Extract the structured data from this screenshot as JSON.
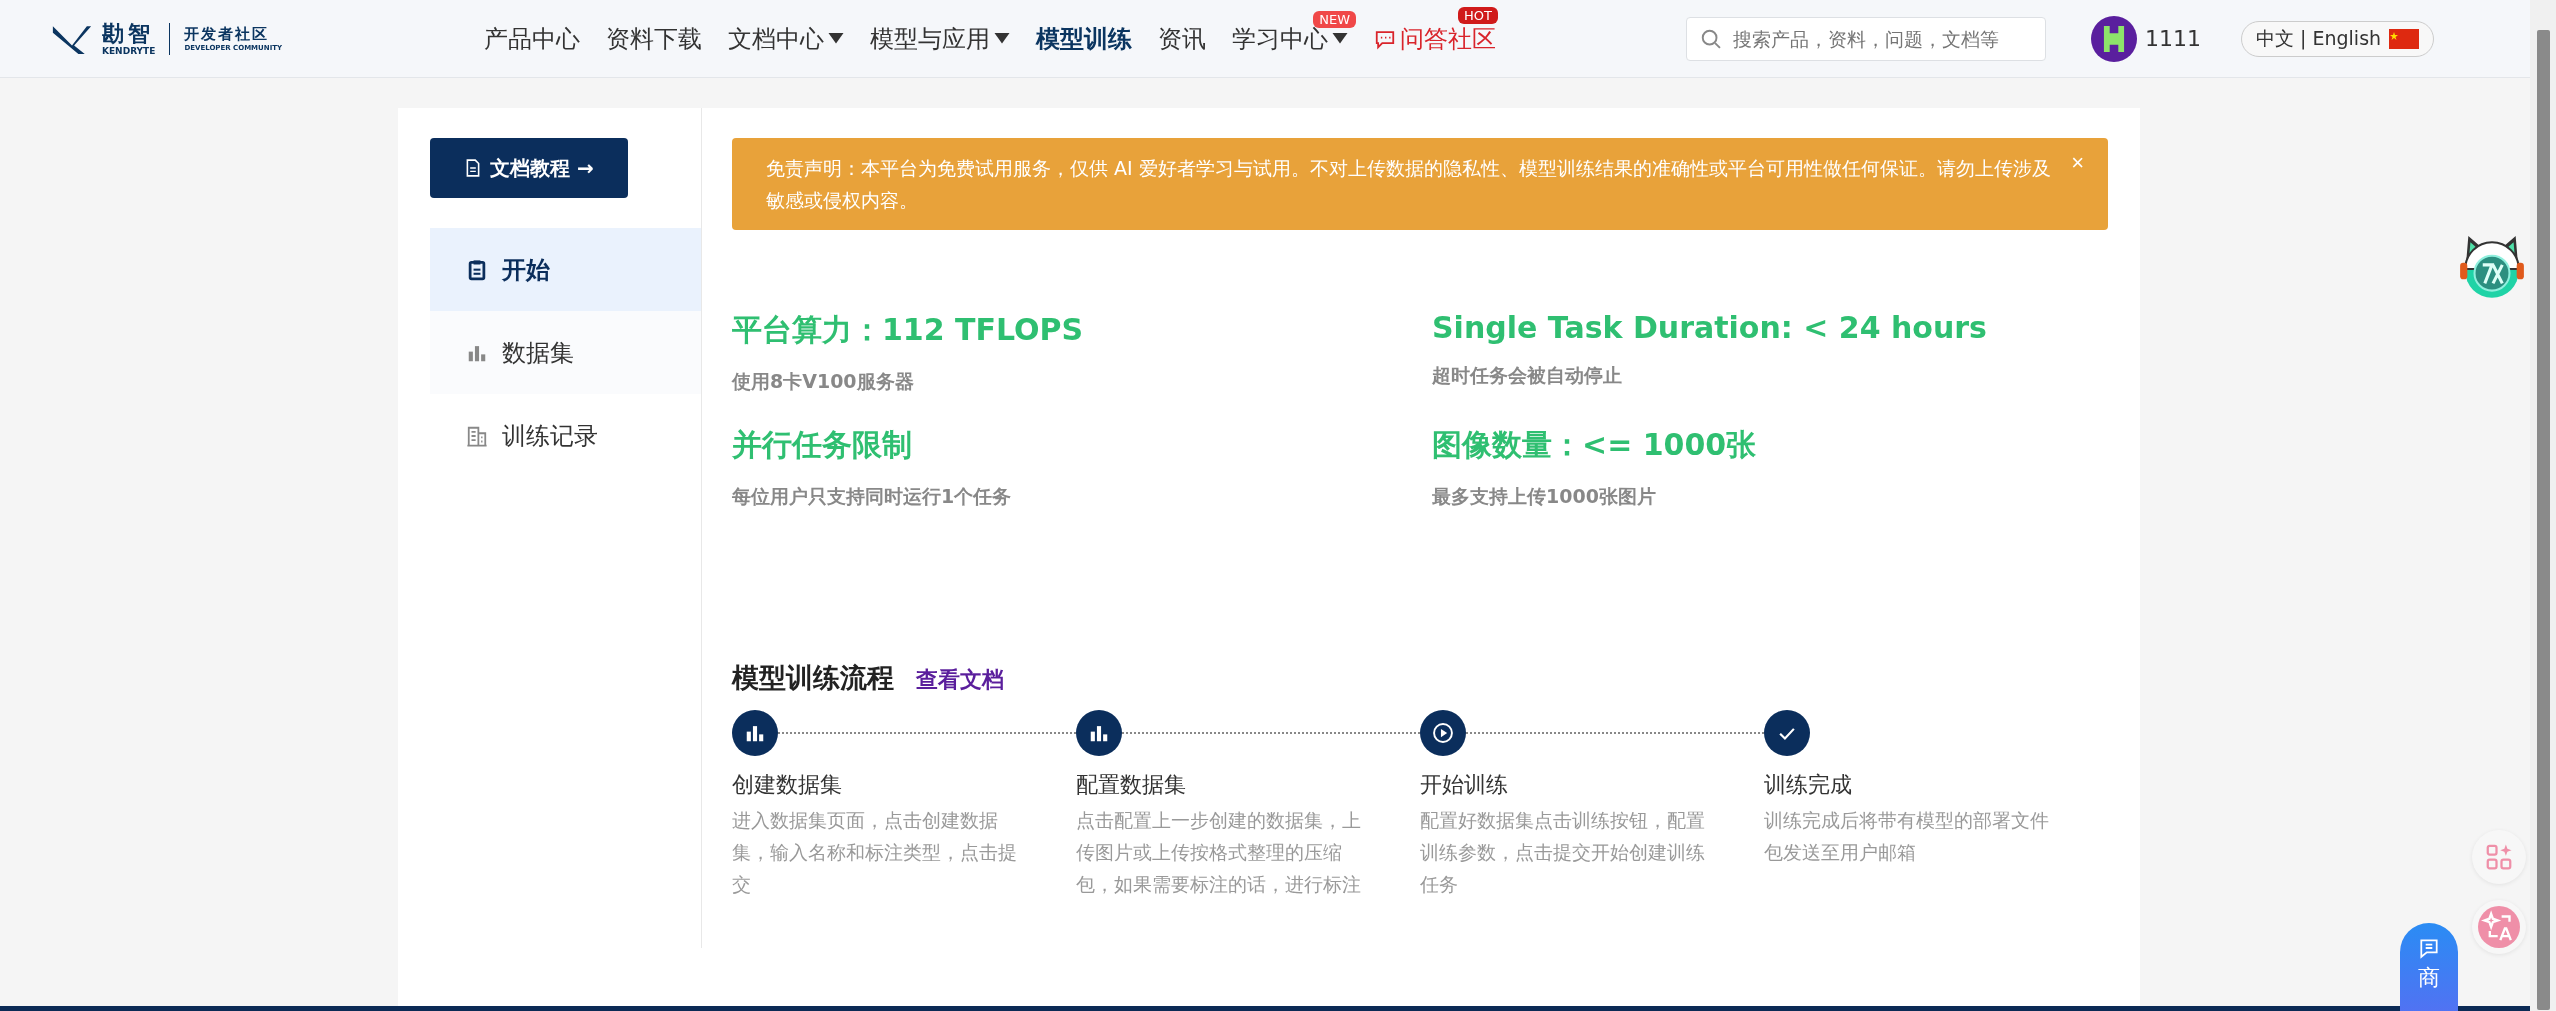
{
  "header": {
    "logo": {
      "mark": "勘智",
      "sub": "KENDRYTE",
      "community": "开发者社区",
      "community_sub": "DEVELOPER COMMUNITY"
    },
    "nav": [
      {
        "label": "产品中心",
        "dropdown": false,
        "selected": false
      },
      {
        "label": "资料下载",
        "dropdown": false,
        "selected": false
      },
      {
        "label": "文档中心",
        "dropdown": true,
        "selected": false
      },
      {
        "label": "模型与应用",
        "dropdown": true,
        "selected": false
      },
      {
        "label": "模型训练",
        "dropdown": false,
        "selected": true
      },
      {
        "label": "资讯",
        "dropdown": false,
        "selected": false
      },
      {
        "label": "学习中心",
        "dropdown": true,
        "selected": false,
        "badge": "NEW"
      },
      {
        "label": "问答社区",
        "dropdown": false,
        "selected": false,
        "badge": "HOT",
        "kind": "community"
      }
    ],
    "search": {
      "placeholder": "搜索产品，资料，问题，文档等"
    },
    "user": {
      "name": "1111"
    },
    "language": {
      "label": "中文 | English"
    }
  },
  "sidebar": {
    "doc_button": "文档教程 →",
    "items": [
      {
        "label": "开始",
        "kind": "clipboard",
        "selected": true
      },
      {
        "label": "数据集",
        "kind": "chart",
        "selected": false
      },
      {
        "label": "训练记录",
        "kind": "building",
        "selected": false
      }
    ]
  },
  "notice": {
    "text": "免责声明：本平台为免费试用服务，仅供 AI 爱好者学习与试用。不对上传数据的隐私性、模型训练结果的准确性或平台可用性做任何保证。请勿上传涉及敏感或侵权内容。",
    "close": "×"
  },
  "stats": [
    {
      "title": "平台算力：112 TFLOPS",
      "desc": "使用8卡V100服务器"
    },
    {
      "title": "Single Task Duration: < 24 hours",
      "desc": "超时任务会被自动停止"
    },
    {
      "title": "并行任务限制",
      "desc": "每位用户只支持同时运行1个任务"
    },
    {
      "title": "图像数量：<= 1000张",
      "desc": "最多支持上传1000张图片"
    }
  ],
  "flow": {
    "title": "模型训练流程",
    "link": "查看文档",
    "steps": [
      {
        "kind": "chart",
        "title": "创建数据集",
        "desc": "进入数据集页面，点击创建数据集，输入名称和标注类型，点击提交"
      },
      {
        "kind": "chart",
        "title": "配置数据集",
        "desc": "点击配置上一步创建的数据集，上传图片或上传按格式整理的压缩包，如果需要标注的话，进行标注"
      },
      {
        "kind": "play",
        "title": "开始训练",
        "desc": "配置好数据集点击训练按钮，配置训练参数，点击提交开始创建训练任务"
      },
      {
        "kind": "check",
        "title": "训练完成",
        "desc": "训练完成后将带有模型的部署文件包发送至用户邮箱"
      }
    ]
  },
  "floating": {
    "contact": "商"
  }
}
